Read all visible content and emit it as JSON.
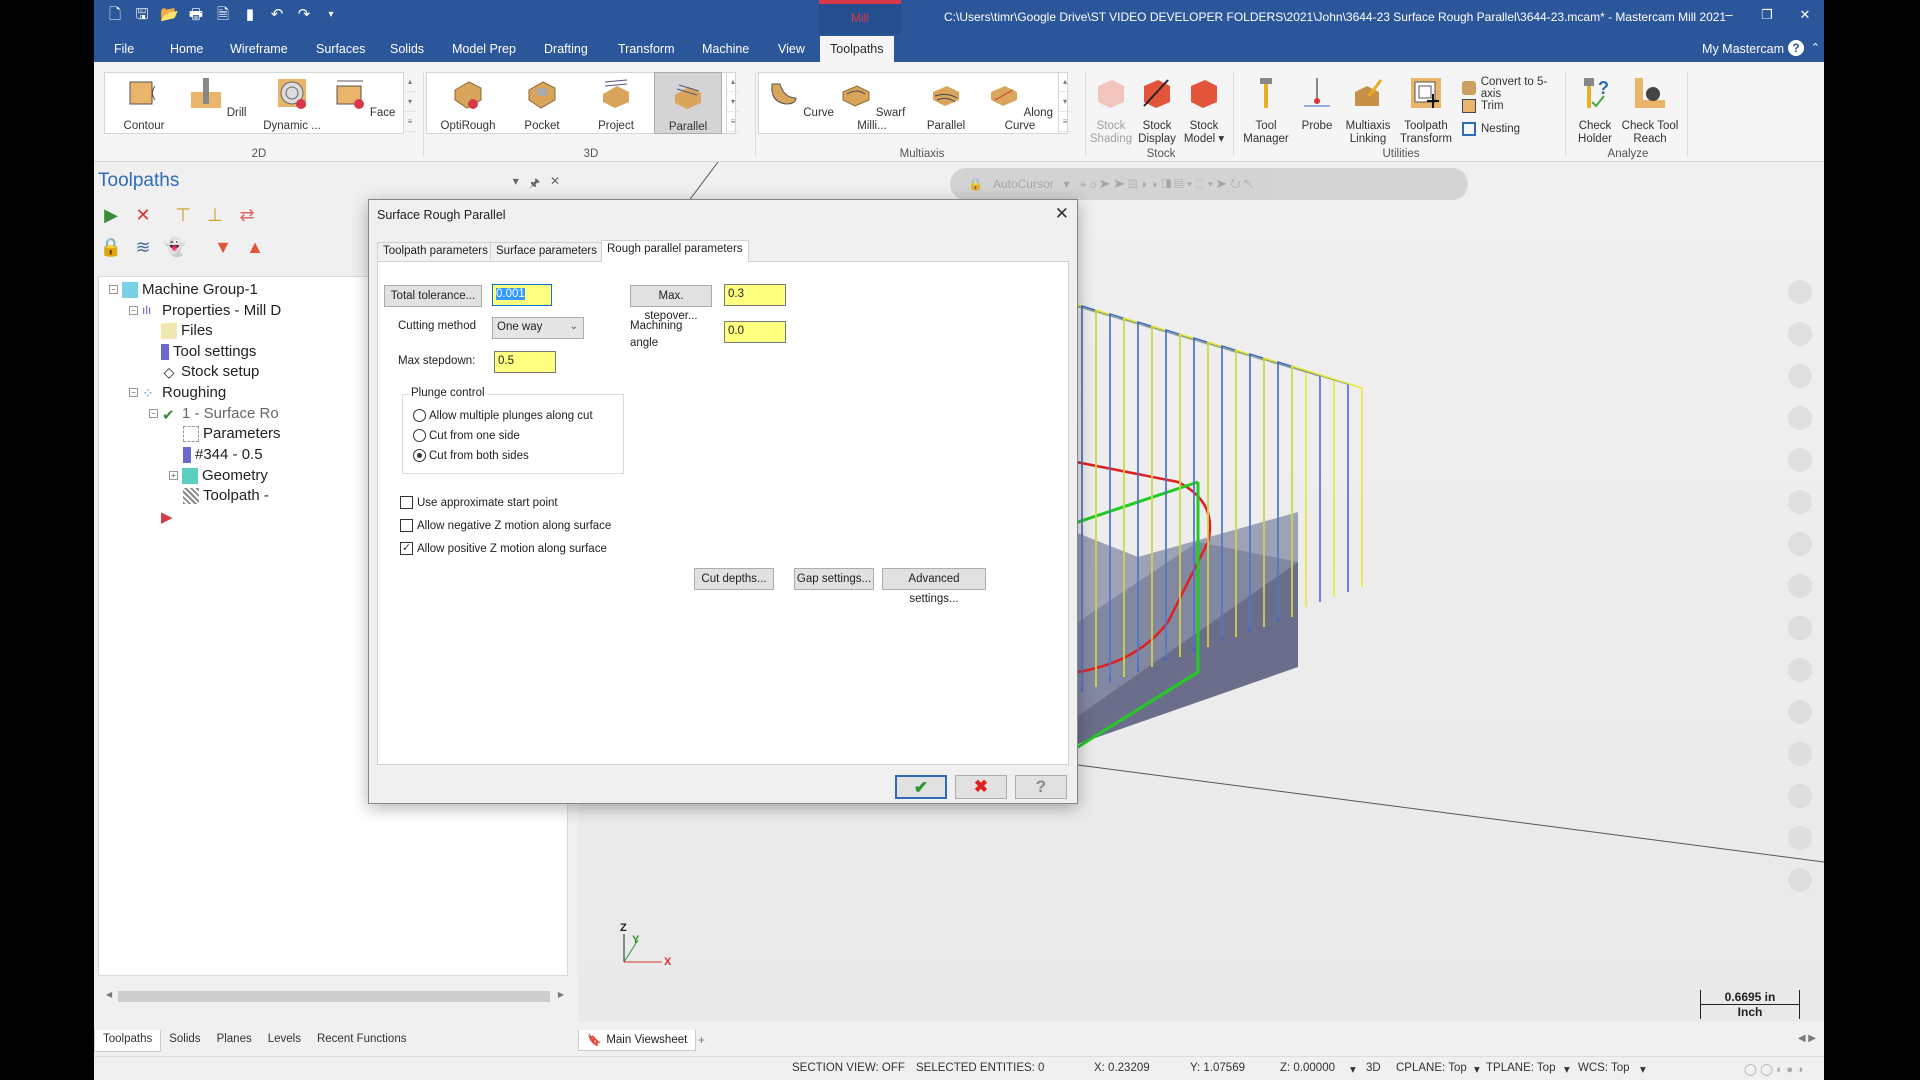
{
  "titlebar": {
    "context_tab": "Mill",
    "window_title": "C:\\Users\\timr\\Google Drive\\ST VIDEO DEVELOPER FOLDERS\\2021\\John\\3644-23 Surface Rough Parallel\\3644-23.mcam* - Mastercam Mill 2021",
    "qat_icons": [
      "new-file-icon",
      "save-icon",
      "open-icon",
      "print-icon",
      "save-as-icon",
      "merge-icon",
      "undo-icon",
      "redo-icon",
      "customize-icon"
    ],
    "controls": {
      "minimize": "–",
      "restore": "❐",
      "close": "✕"
    }
  },
  "menu": {
    "tabs": [
      "File",
      "Home",
      "Wireframe",
      "Surfaces",
      "Solids",
      "Model Prep",
      "Drafting",
      "Transform",
      "Machine",
      "View",
      "Toolpaths"
    ],
    "active": "Toolpaths",
    "my_mastercam": "My Mastercam",
    "help": "?"
  },
  "ribbon": {
    "groups": [
      {
        "label": "2D",
        "buttons": [
          "Contour",
          "Drill",
          "Dynamic ...",
          "Face"
        ]
      },
      {
        "label": "3D",
        "buttons": [
          "OptiRough",
          "Pocket",
          "Project",
          "Parallel"
        ],
        "selected": "Parallel"
      },
      {
        "label": "Multiaxis",
        "buttons": [
          "Curve",
          "Swarf Milli...",
          "Parallel",
          "Along Curve"
        ]
      },
      {
        "label": "Stock",
        "buttons": [
          "Stock Shading",
          "Stock Display",
          "Stock Model ▾"
        ]
      },
      {
        "label": "Utilities",
        "buttons": [
          "Tool Manager",
          "Probe",
          "Multiaxis Linking",
          "Toolpath Transform"
        ],
        "small_buttons": [
          "Convert to 5-axis",
          "Trim",
          "Nesting"
        ]
      },
      {
        "label": "Analyze",
        "buttons": [
          "Check Holder",
          "Check Tool Reach"
        ]
      }
    ]
  },
  "left_panel": {
    "title": "Toolpaths",
    "tree": [
      {
        "label": "Machine Group-1",
        "level": 0
      },
      {
        "label": "Properties - Mill D",
        "level": 1
      },
      {
        "label": "Files",
        "level": 2
      },
      {
        "label": "Tool settings",
        "level": 2
      },
      {
        "label": "Stock setup",
        "level": 2
      },
      {
        "label": "Roughing",
        "level": 1
      },
      {
        "label": "1 - Surface Ro",
        "level": 2
      },
      {
        "label": "Parameters",
        "level": 3
      },
      {
        "label": "#344 - 0.5",
        "level": 3
      },
      {
        "label": "Geometry",
        "level": 3
      },
      {
        "label": "Toolpath -",
        "level": 3
      }
    ],
    "bottom_tabs": [
      "Toolpaths",
      "Solids",
      "Planes",
      "Levels",
      "Recent Functions"
    ],
    "active_tab": "Toolpaths"
  },
  "viewport": {
    "autocursor": "AutoCursor",
    "scale_value": "0.6695 in",
    "scale_unit": "Inch",
    "viewsheet_tab": "Main Viewsheet",
    "add_tab": "+",
    "axis": {
      "x": "X",
      "y": "Y",
      "z": "Z"
    }
  },
  "dialog": {
    "title": "Surface Rough Parallel",
    "tabs": [
      "Toolpath parameters",
      "Surface parameters",
      "Rough parallel parameters"
    ],
    "active_tab": "Rough parallel parameters",
    "total_tolerance_button": "Total tolerance...",
    "total_tolerance": "0.001",
    "cutting_method_label": "Cutting method",
    "cutting_method": "One way",
    "max_stepdown_label": "Max stepdown:",
    "max_stepdown": "0.5",
    "max_stepover_button": "Max. stepover...",
    "max_stepover": "0.3",
    "machining_angle_label": "Machining angle",
    "machining_angle": "0.0",
    "plunge_control": {
      "legend": "Plunge control",
      "options": [
        "Allow multiple plunges along cut",
        "Cut from one side",
        "Cut from both sides"
      ],
      "selected": "Cut from both sides"
    },
    "checkboxes": [
      {
        "label": "Use approximate start point",
        "checked": false
      },
      {
        "label": "Allow negative Z motion along surface",
        "checked": false
      },
      {
        "label": "Allow positive Z motion along surface",
        "checked": true
      }
    ],
    "buttons": [
      "Cut depths...",
      "Gap settings...",
      "Advanced settings..."
    ],
    "ok": "✔",
    "cancel": "✖",
    "help": "?"
  },
  "status": {
    "section_view": "SECTION VIEW: OFF",
    "selected": "SELECTED ENTITIES: 0",
    "x": "X:  0.23209",
    "y": "Y:  1.07569",
    "z": "Z:  0.00000",
    "mode": "3D",
    "cplane": "CPLANE: Top",
    "tplane": "TPLANE: Top",
    "wcs": "WCS: Top"
  },
  "colors": {
    "brand": "#2b579a",
    "context": "#d8394a",
    "field": "#ffff80",
    "toolpath_blue": "#3a63e0",
    "toolpath_yellow": "#e8e82a",
    "chain_green": "#22cc22",
    "boundary_red": "#e02020"
  }
}
